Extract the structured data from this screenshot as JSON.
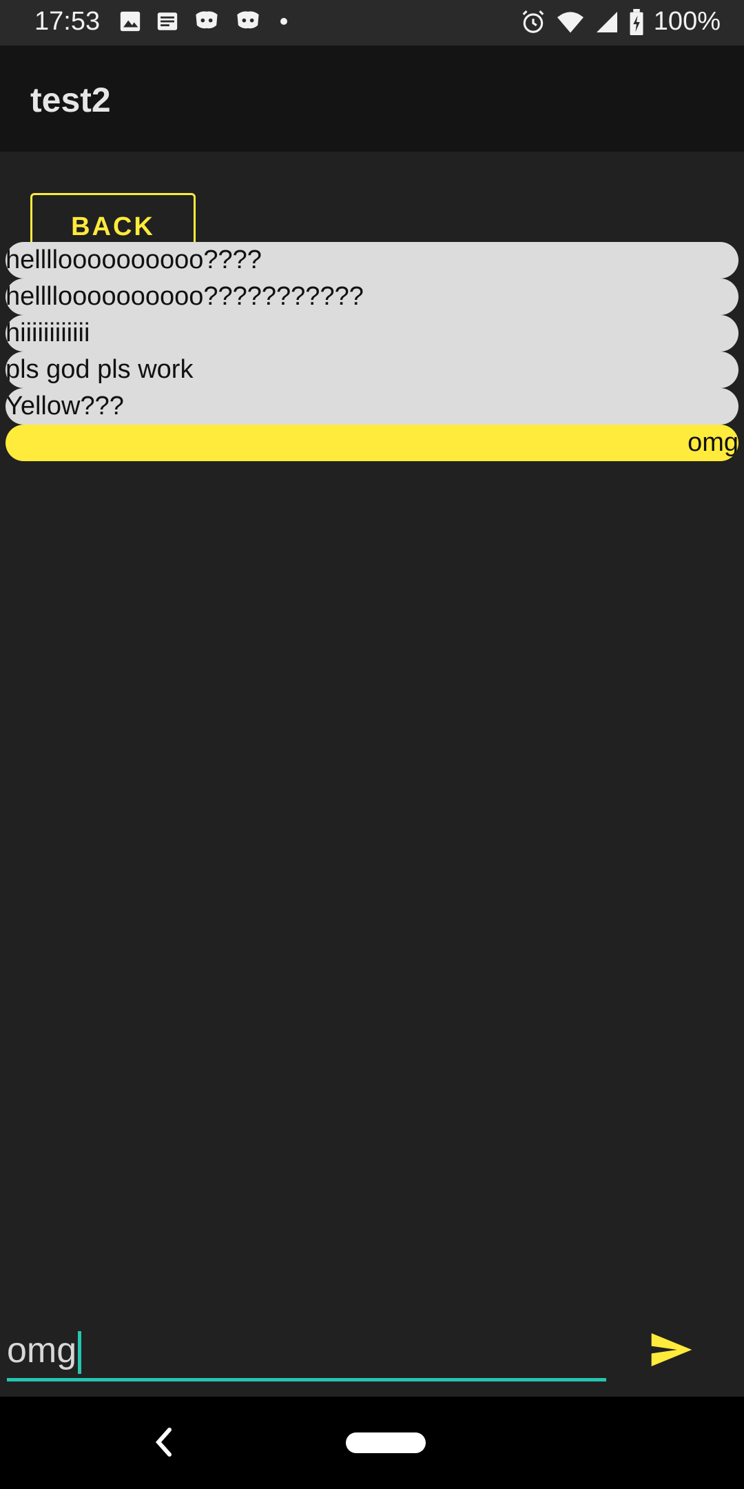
{
  "status_bar": {
    "time": "17:53",
    "battery_text": "100%",
    "icons": [
      "image-icon",
      "news-icon",
      "discord-icon",
      "discord-icon",
      "dot-icon",
      "alarm-icon",
      "wifi-icon",
      "signal-icon",
      "battery-icon"
    ]
  },
  "app_bar": {
    "title": "test2"
  },
  "back_button": {
    "label": "BACK"
  },
  "messages": [
    {
      "text": "helllloooooooooo????",
      "mine": false
    },
    {
      "text": "helllloooooooooo???????????",
      "mine": false
    },
    {
      "text": "hiiiiiiiiiiii",
      "mine": false
    },
    {
      "text": "pls god pls work",
      "mine": false
    },
    {
      "text": "Yellow???",
      "mine": false
    },
    {
      "text": "omg",
      "mine": true
    }
  ],
  "composer": {
    "value": "omg",
    "send_icon": "send-icon"
  },
  "colors": {
    "background": "#212121",
    "accent": "#ffeb3b",
    "incoming_bubble": "#dcdcdc",
    "input_underline": "#26c6b0"
  }
}
